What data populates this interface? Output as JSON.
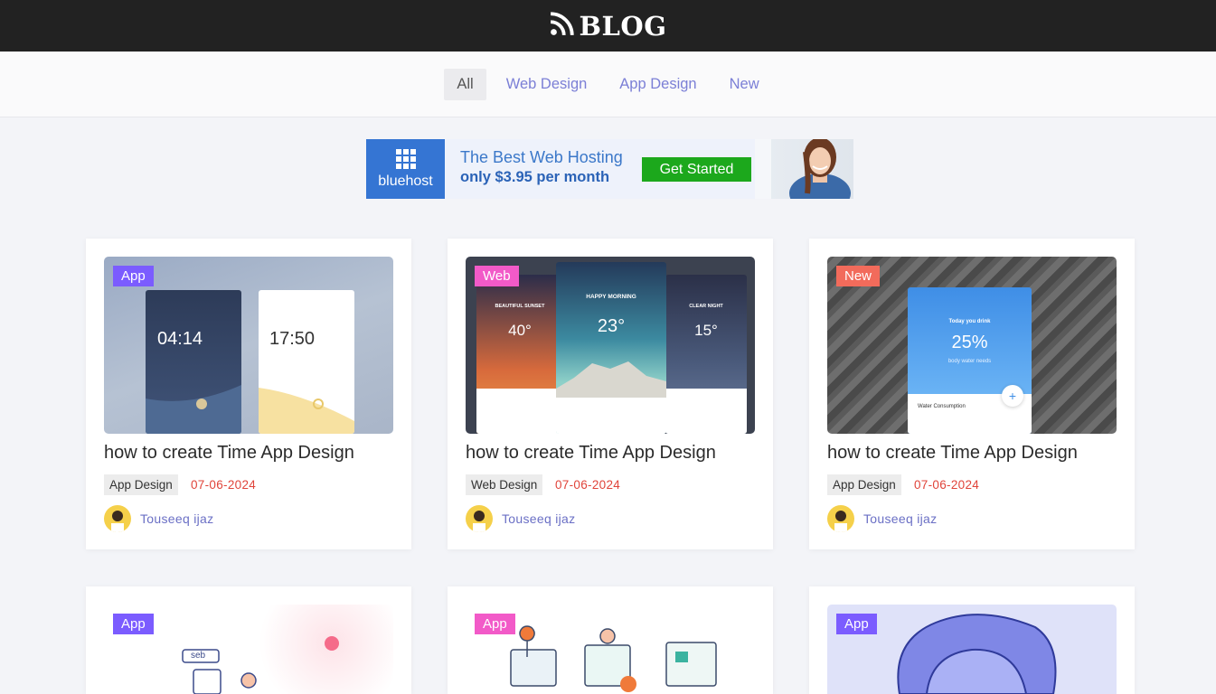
{
  "header": {
    "title": "BLOG",
    "rss_icon": "rss-icon"
  },
  "filters": [
    {
      "label": "All",
      "active": true
    },
    {
      "label": "Web Design",
      "active": false
    },
    {
      "label": "App Design",
      "active": false
    },
    {
      "label": "New",
      "active": false
    }
  ],
  "ad": {
    "brand": "bluehost",
    "headline": "The Best Web Hosting",
    "subline": "only  $3.95  per month",
    "cta": "Get Started"
  },
  "cards": [
    {
      "badge": "App",
      "badge_color": "#7b5cff",
      "thumb_texts": [
        "04:14",
        "17:50"
      ],
      "title": "how to create Time App Design",
      "category": "App Design",
      "date": "07-06-2024",
      "author": "Touseeq ijaz"
    },
    {
      "badge": "Web",
      "badge_color": "#f25ac8",
      "thumb_texts": [
        "HAPPY MORNING",
        "23°",
        "BEAUTIFUL SUNSET",
        "40°",
        "CLEAR NIGHT",
        "15°"
      ],
      "title": "how to create Time App Design",
      "category": "Web Design",
      "date": "07-06-2024",
      "author": "Touseeq ijaz"
    },
    {
      "badge": "New",
      "badge_color": "#f26b5b",
      "thumb_texts": [
        "Today you drink",
        "25%",
        "body water needs",
        "Water Consumption"
      ],
      "title": "how to create Time App Design",
      "category": "App Design",
      "date": "07-06-2024",
      "author": "Touseeq ijaz"
    },
    {
      "badge": "App",
      "badge_color": "#7b5cff",
      "thumb_texts": [
        "seb"
      ]
    },
    {
      "badge": "App",
      "badge_color": "#f25ac8"
    },
    {
      "badge": "App",
      "badge_color": "#7b5cff"
    }
  ]
}
